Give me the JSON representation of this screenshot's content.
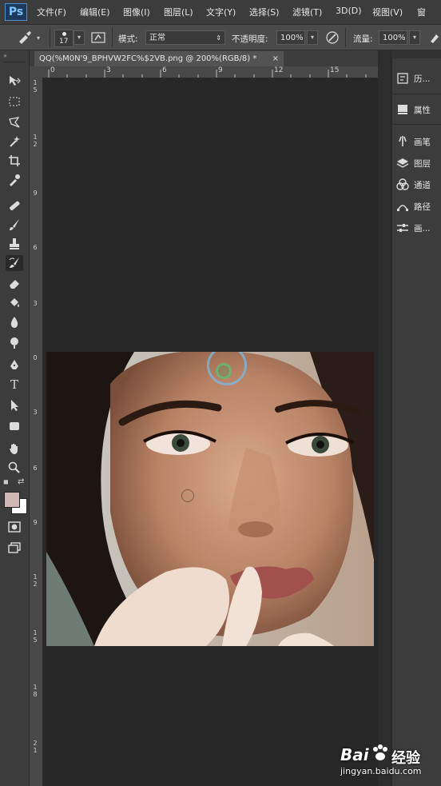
{
  "app": {
    "logo": "Ps"
  },
  "menu": [
    "文件(F)",
    "编辑(E)",
    "图像(I)",
    "图层(L)",
    "文字(Y)",
    "选择(S)",
    "滤镜(T)",
    "3D(D)",
    "视图(V)",
    "窗"
  ],
  "options": {
    "brush_size": "17",
    "mode_label": "模式:",
    "mode_value": "正常",
    "opacity_label": "不透明度:",
    "opacity_value": "100%",
    "flow_label": "流量:",
    "flow_value": "100%"
  },
  "document": {
    "tab_title": "QQ(%M0N'9_BPHVW2FC%$2VB.png @ 200%(RGB/8) *",
    "close_glyph": "×"
  },
  "ruler": {
    "h_ticks": [
      "0",
      "3",
      "6",
      "9",
      "12",
      "15"
    ],
    "v_ticks": [
      "1\n5",
      "1\n2",
      "9",
      "6",
      "3",
      "0",
      "3",
      "6",
      "9",
      "1\n2",
      "1\n5",
      "1\n8",
      "2\n1"
    ]
  },
  "tools": [
    "move-icon",
    "marquee-icon",
    "lasso-icon",
    "magic-wand-icon",
    "crop-icon",
    "eyedropper-icon",
    "spot-healing-icon",
    "brush-icon",
    "stamp-icon",
    "history-brush-icon",
    "eraser-icon",
    "paint-bucket-icon",
    "blur-icon",
    "dodge-icon",
    "pen-icon",
    "type-icon",
    "path-select-icon",
    "shape-icon",
    "hand-icon",
    "zoom-icon"
  ],
  "colors": {
    "foreground": "#d2b8b4",
    "background": "#ffffff",
    "accent": "#4c8ccc"
  },
  "panels": {
    "group1": [
      {
        "icon": "history-icon",
        "label": "历..."
      }
    ],
    "group2": [
      {
        "icon": "properties-icon",
        "label": "属性"
      }
    ],
    "group3": [
      {
        "icon": "brush-panel-icon",
        "label": "画笔"
      },
      {
        "icon": "layers-icon",
        "label": "图层"
      },
      {
        "icon": "channels-icon",
        "label": "通道"
      },
      {
        "icon": "paths-icon",
        "label": "路径"
      },
      {
        "icon": "brush-preset-icon",
        "label": "画..."
      }
    ]
  },
  "watermark": {
    "brand": "Bai",
    "brand2": "经验",
    "url": "jingyan.baidu.com"
  }
}
